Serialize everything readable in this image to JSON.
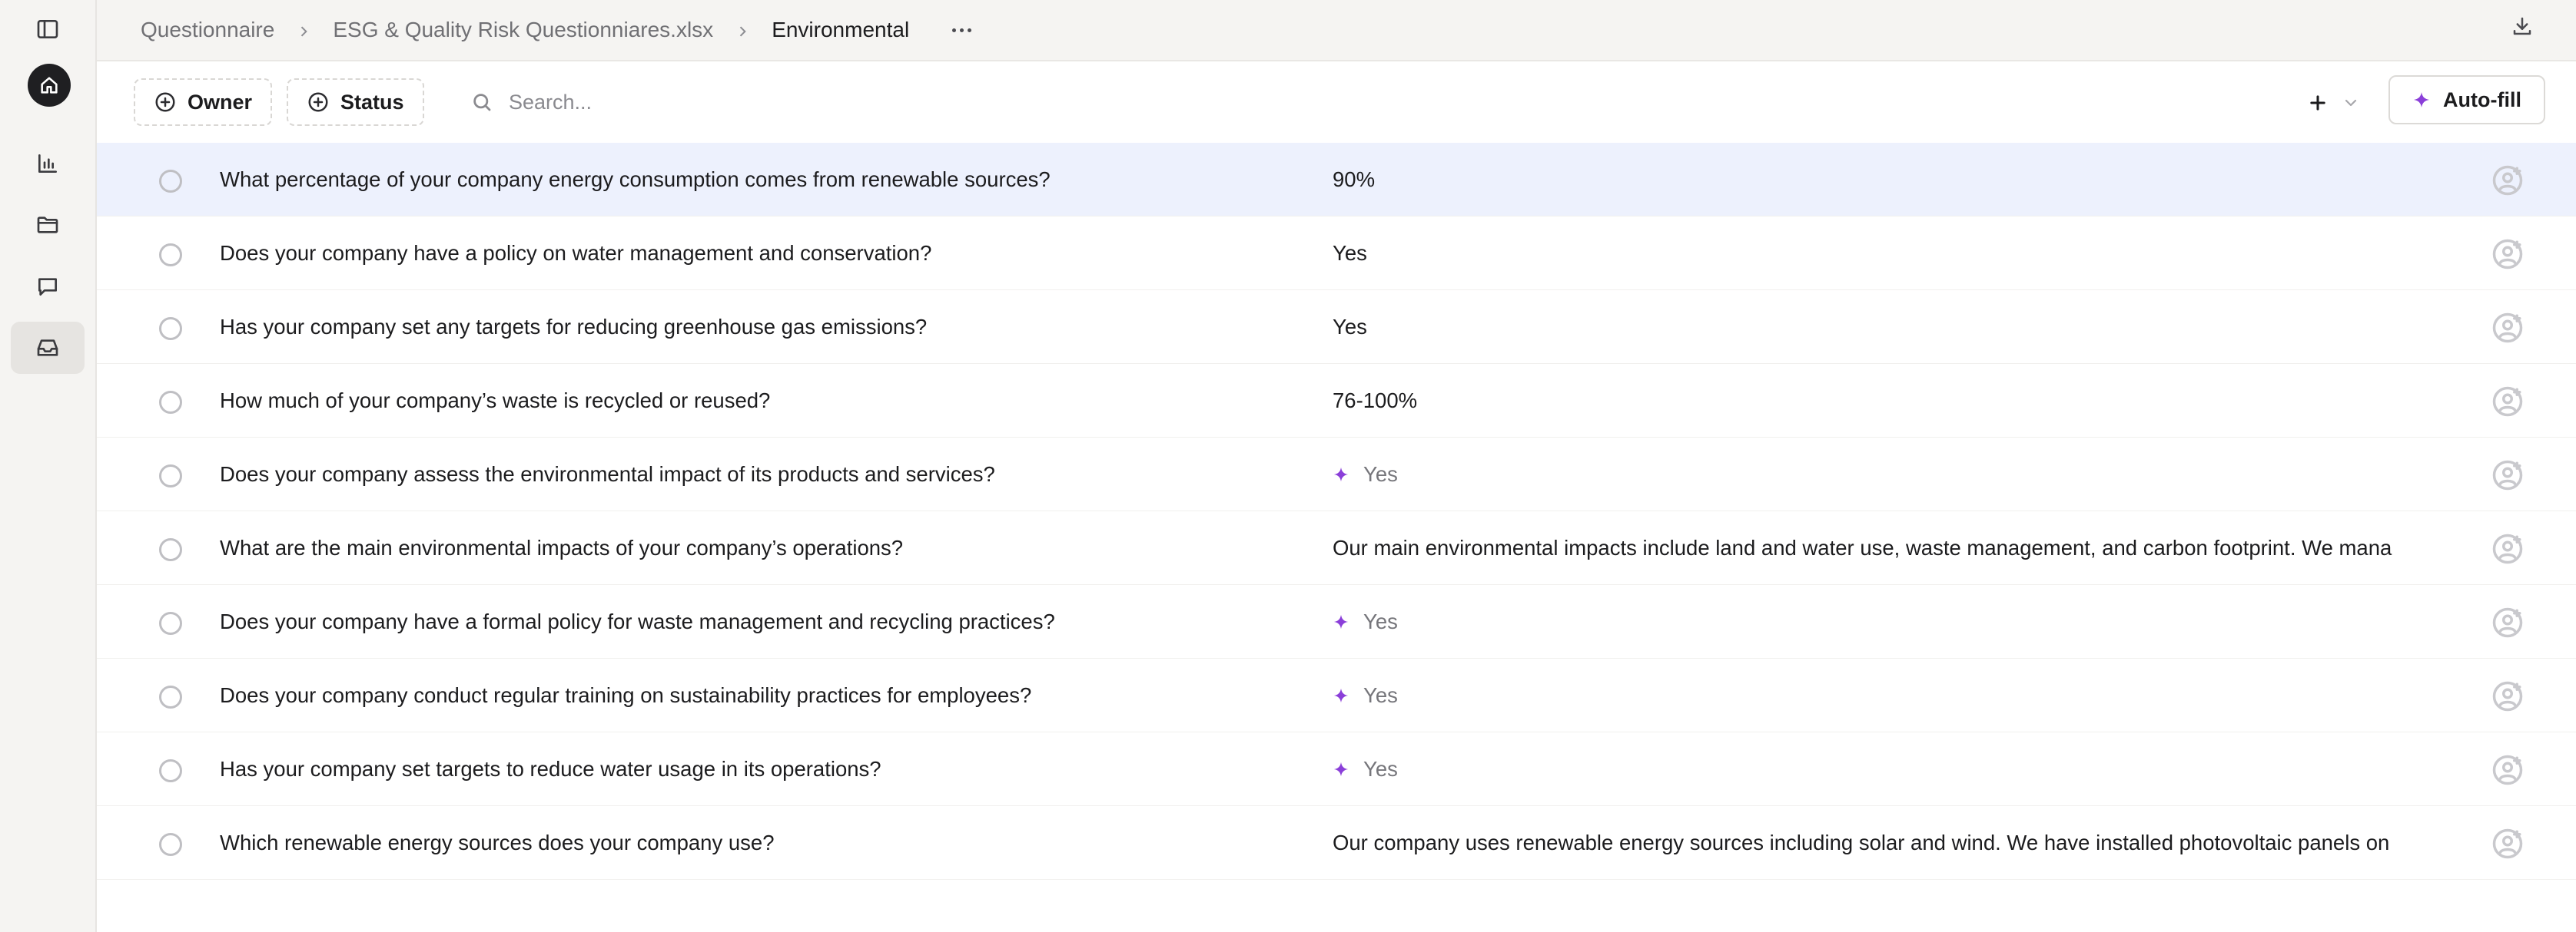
{
  "sidebar": {
    "items": [
      {
        "name": "toggle-sidebar",
        "icon": "sidebar-panel-icon"
      },
      {
        "name": "home",
        "icon": "home-icon"
      },
      {
        "name": "analytics",
        "icon": "bar-chart-icon"
      },
      {
        "name": "files",
        "icon": "folder-icon"
      },
      {
        "name": "chat",
        "icon": "message-icon"
      },
      {
        "name": "inbox",
        "icon": "inbox-icon",
        "active": true
      }
    ]
  },
  "breadcrumb": {
    "items": [
      "Questionnaire",
      "ESG & Quality Risk Questionniares.xlsx",
      "Environmental"
    ]
  },
  "toolbar": {
    "owner_label": "Owner",
    "status_label": "Status",
    "search_placeholder": "Search...",
    "autofill_label": "Auto-fill"
  },
  "colors": {
    "accent": "#8b3fd9",
    "selected_row": "#edf1fd",
    "rail_bg": "#f5f4f2"
  },
  "rows": [
    {
      "question": "What percentage of your company energy consumption comes from renewable sources?",
      "answer": "90%",
      "suggested": false,
      "selected": true
    },
    {
      "question": "Does your company have a policy on water management and conservation?",
      "answer": "Yes",
      "suggested": false
    },
    {
      "question": "Has your company set any targets for reducing greenhouse gas emissions?",
      "answer": "Yes",
      "suggested": false
    },
    {
      "question": "How much of your company’s waste is recycled or reused?",
      "answer": "76-100%",
      "suggested": false
    },
    {
      "question": "Does your company assess the environmental impact of its products and services?",
      "answer": "Yes",
      "suggested": true
    },
    {
      "question": "What are the main environmental impacts of your company’s operations?",
      "answer": "Our main environmental impacts include land and water use, waste management, and carbon footprint. We mana",
      "suggested": false
    },
    {
      "question": "Does your company have a formal policy for waste management and recycling practices?",
      "answer": "Yes",
      "suggested": true
    },
    {
      "question": "Does your company conduct regular training on sustainability practices for employees?",
      "answer": "Yes",
      "suggested": true
    },
    {
      "question": "Has your company set targets to reduce water usage in its operations?",
      "answer": "Yes",
      "suggested": true
    },
    {
      "question": "Which renewable energy sources does your company use?",
      "answer": "Our company uses renewable energy sources including solar and wind. We have installed photovoltaic panels on",
      "suggested": false
    }
  ]
}
